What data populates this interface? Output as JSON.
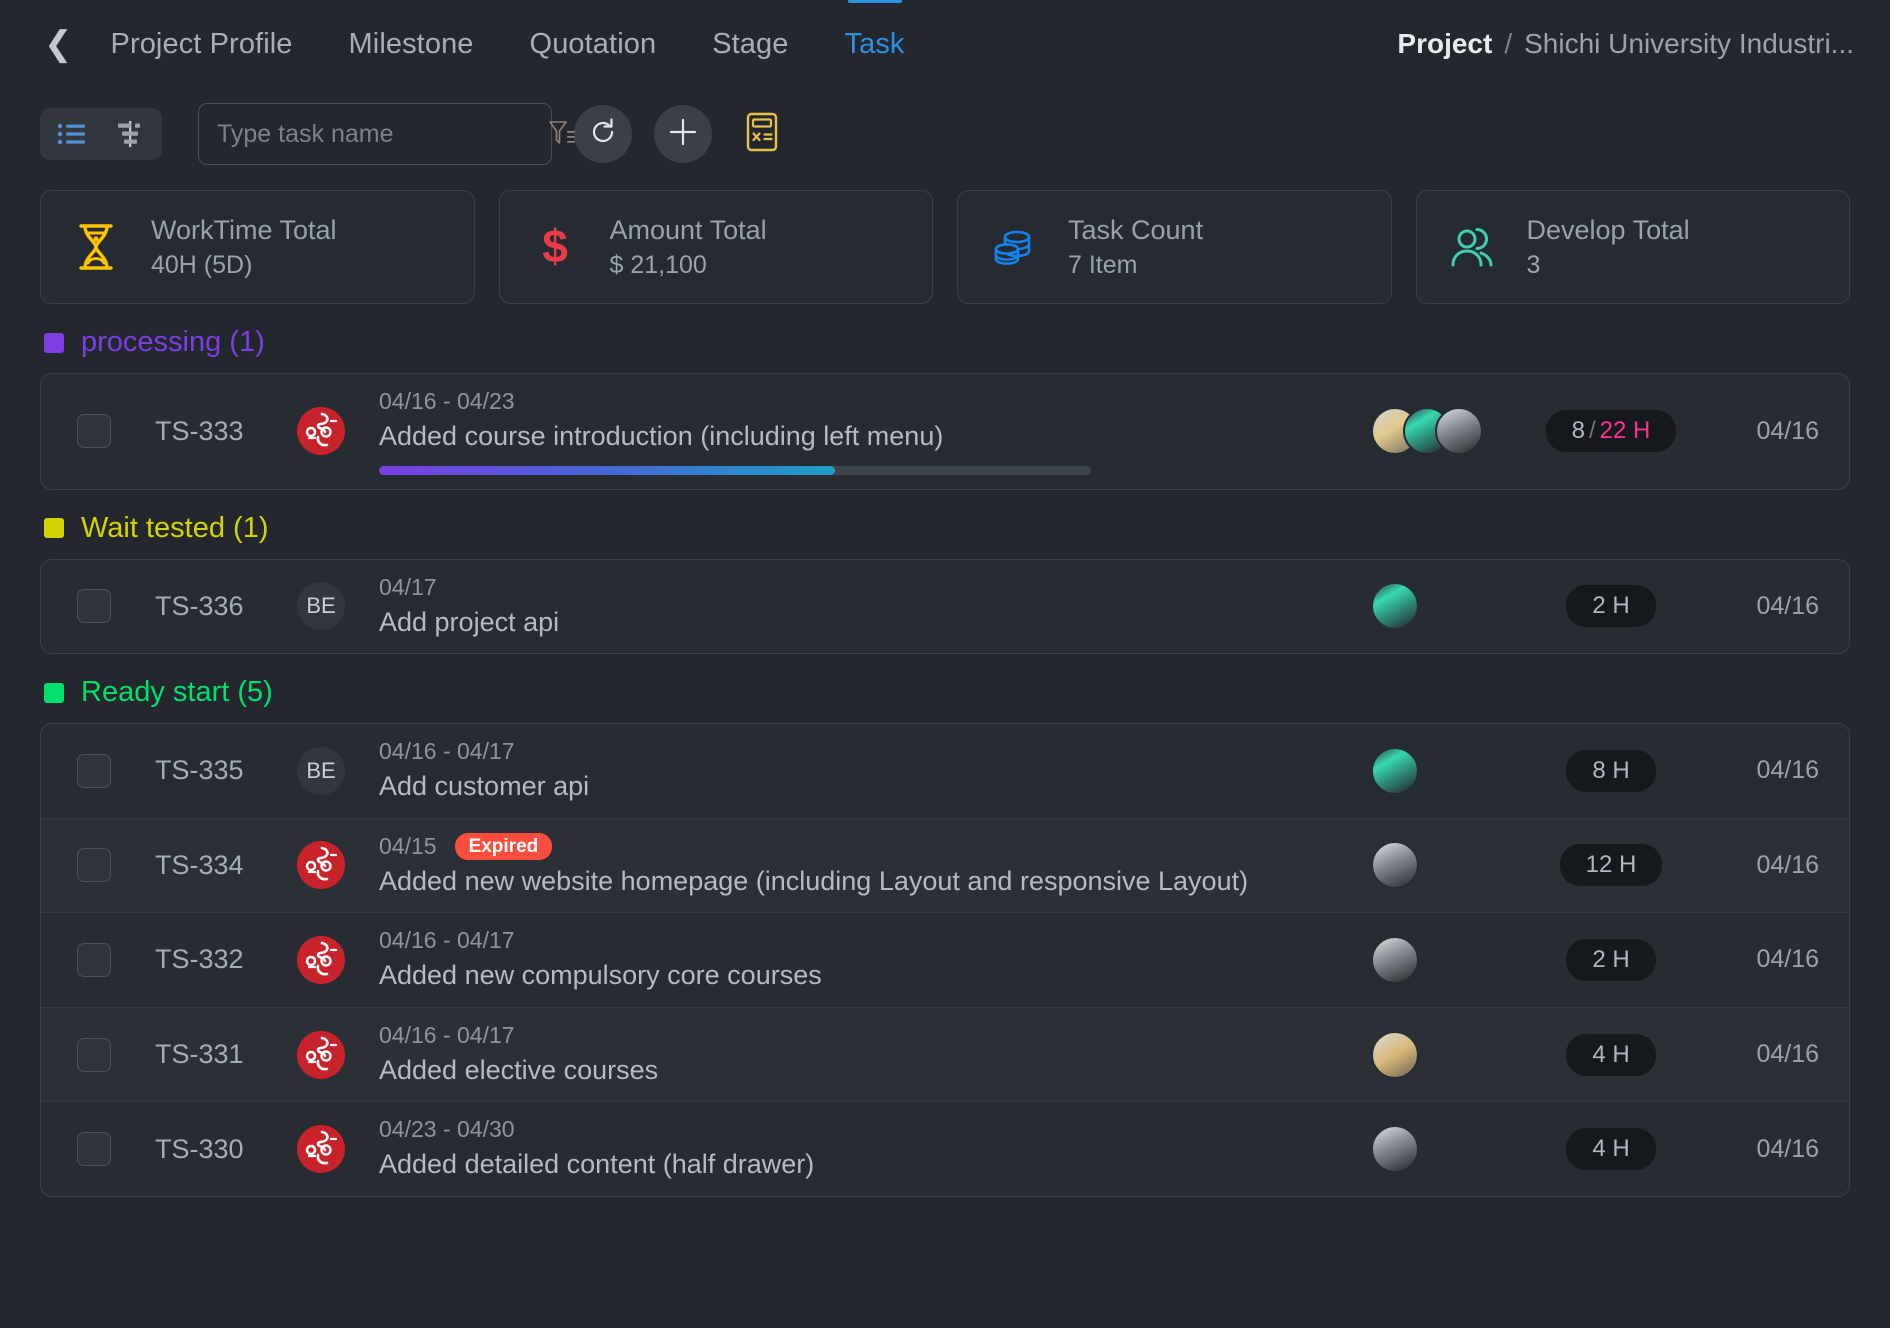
{
  "nav": {
    "back_icon": "chevron-left-icon",
    "tabs": [
      {
        "label": "Project Profile",
        "active": false
      },
      {
        "label": "Milestone",
        "active": false
      },
      {
        "label": "Quotation",
        "active": false
      },
      {
        "label": "Stage",
        "active": false
      },
      {
        "label": "Task",
        "active": true
      }
    ],
    "breadcrumb": {
      "root": "Project",
      "separator": "/",
      "leaf": "Shichi University Industri..."
    }
  },
  "toolbar": {
    "view_list_icon": "list-view-icon",
    "view_gantt_icon": "gantt-view-icon",
    "search": {
      "value": "",
      "placeholder": "Type task name"
    },
    "filter_icon": "filter-funnel-icon",
    "refresh_icon": "refresh-icon",
    "add_icon": "plus-icon",
    "calculator_icon": "calculator-icon",
    "accent_blue": "#2a92e0",
    "accent_gold": "#e8c14a"
  },
  "stats": [
    {
      "label": "WorkTime Total",
      "value": "40H (5D)",
      "icon": "hourglass-icon",
      "color": "#fdc300"
    },
    {
      "label": "Amount Total",
      "value": "$ 21,100",
      "icon": "dollar-icon",
      "color": "#ea3b47"
    },
    {
      "label": "Task Count",
      "value": "7 Item",
      "icon": "coins-stack-icon",
      "color": "#1383f0"
    },
    {
      "label": "Develop Total",
      "value": "3",
      "icon": "users-icon",
      "color": "#3ecfb2"
    }
  ],
  "groups": [
    {
      "label": "processing (1)",
      "color": "#7b3fe4",
      "tasks": [
        {
          "code": "TS-333",
          "avatar": "logo",
          "dates": "04/16 - 04/23",
          "expired": null,
          "title": "Added course introduction (including left menu)",
          "progress": 64,
          "assignees": [
            "ph1",
            "ph2",
            "ph3"
          ],
          "hours": "8 / 22 H",
          "hours_spent": "8",
          "hours_total": "22 H",
          "date": "04/16"
        }
      ]
    },
    {
      "label": "Wait tested (1)",
      "color": "#d4d400",
      "tasks": [
        {
          "code": "TS-336",
          "avatar": "BE",
          "dates": "04/17",
          "expired": null,
          "title": "Add project api",
          "progress": null,
          "assignees": [
            "ph2"
          ],
          "hours": "2 H",
          "date": "04/16"
        }
      ]
    },
    {
      "label": "Ready start (5)",
      "color": "#00e06a",
      "tasks": [
        {
          "code": "TS-335",
          "avatar": "BE",
          "dates": "04/16 - 04/17",
          "expired": null,
          "title": "Add customer api",
          "progress": null,
          "assignees": [
            "ph2"
          ],
          "hours": "8 H",
          "date": "04/16"
        },
        {
          "code": "TS-334",
          "avatar": "logo",
          "dates": "04/15",
          "expired": "Expired",
          "title": "Added new website homepage (including Layout and responsive Layout)",
          "progress": null,
          "assignees": [
            "ph3"
          ],
          "hours": "12 H",
          "date": "04/16"
        },
        {
          "code": "TS-332",
          "avatar": "logo",
          "dates": "04/16 - 04/17",
          "expired": null,
          "title": "Added new compulsory core courses",
          "progress": null,
          "assignees": [
            "ph3"
          ],
          "hours": "2 H",
          "date": "04/16"
        },
        {
          "code": "TS-331",
          "avatar": "logo",
          "dates": "04/16 - 04/17",
          "expired": null,
          "title": "Added elective courses",
          "progress": null,
          "assignees": [
            "ph4"
          ],
          "hours": "4 H",
          "date": "04/16"
        },
        {
          "code": "TS-330",
          "avatar": "logo",
          "dates": "04/23 - 04/30",
          "expired": null,
          "title": "Added detailed content (half drawer)",
          "progress": null,
          "assignees": [
            "ph3"
          ],
          "hours": "4 H",
          "date": "04/16"
        }
      ]
    }
  ]
}
